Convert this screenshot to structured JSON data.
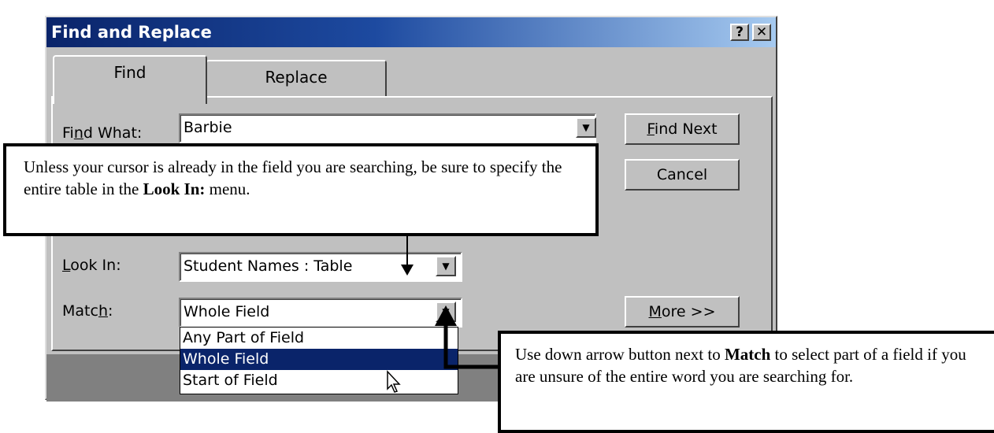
{
  "dialog": {
    "title": "Find and Replace",
    "help_button": "?",
    "close_button": "✕",
    "tabs": [
      {
        "label": "Find",
        "active": true
      },
      {
        "label": "Replace",
        "active": false
      }
    ],
    "find_what": {
      "label_pre": "Fi",
      "label_u": "n",
      "label_post": "d What:",
      "value": "Barbie"
    },
    "look_in": {
      "label_u": "L",
      "label_post": "ook In:",
      "value": "Student Names : Table"
    },
    "match": {
      "label_pre": "Matc",
      "label_u": "h",
      "label_post": ":",
      "value": "Whole Field",
      "options": [
        "Any Part of Field",
        "Whole Field",
        "Start of Field"
      ],
      "selected": "Whole Field"
    },
    "buttons": {
      "find_next_u": "F",
      "find_next_post": "ind Next",
      "cancel": "Cancel",
      "more_u": "M",
      "more_post": "ore >>"
    }
  },
  "callouts": {
    "top": {
      "pre": "Unless your cursor is already in the field you are searching, be sure to specify the entire table in the ",
      "bold": "Look In:",
      "post": " menu."
    },
    "bottom": {
      "pre": "Use down arrow button next to ",
      "bold": "Match",
      "post": " to select part of a field if you are unsure of the entire word you are searching for."
    }
  },
  "colors": {
    "title_bar": "#0a246a",
    "selection": "#0a246a",
    "dialog_face": "#c0c0c0"
  }
}
